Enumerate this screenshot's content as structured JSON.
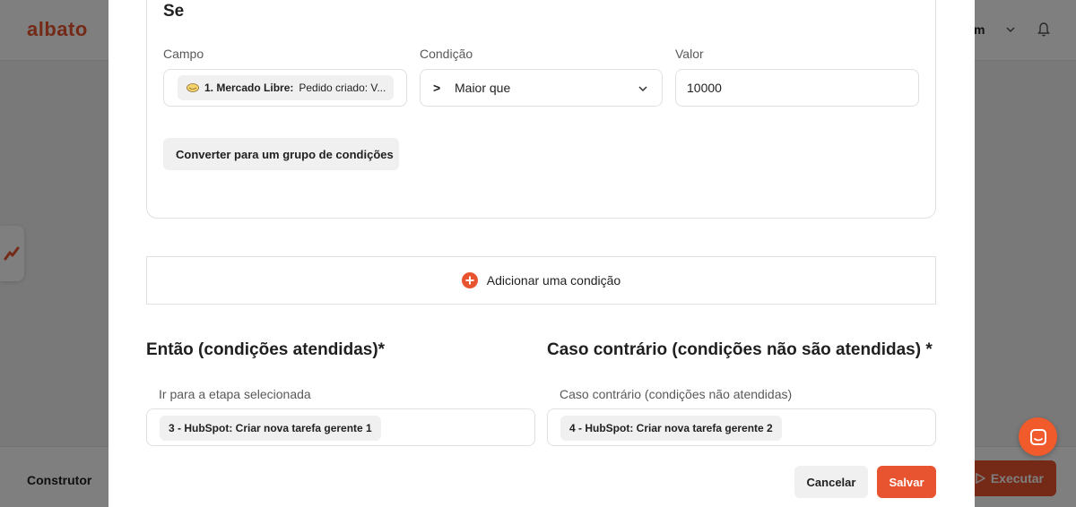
{
  "app": {
    "logo": "albato",
    "user_fragment": "m",
    "builder_label": "Construtor",
    "run_label": "Executar"
  },
  "colors": {
    "accent": "#e8542f",
    "chip_bg": "#f0f0f0",
    "border": "#e0e0e0"
  },
  "modal": {
    "if_title": "Se",
    "field_label": "Campo",
    "field_chip": {
      "bold": "1. Mercado Libre:",
      "rest": "Pedido criado: V..."
    },
    "condition_label": "Condição",
    "condition_op": ">",
    "condition_value": "Maior que",
    "value_label": "Valor",
    "value": "10000",
    "convert_label": "Converter para um grupo de condições",
    "add_condition_label": "Adicionar uma condição",
    "then_title": "Então (condições atendidas)*",
    "then_sub": "Ir para a etapa selecionada",
    "then_step": "3 - HubSpot: Criar nova tarefa gerente 1",
    "else_title": "Caso contrário (condições não são atendidas) *",
    "else_sub": "Caso contrário (condições não atendidas)",
    "else_step": "4 - HubSpot: Criar nova tarefa gerente 2",
    "cancel_label": "Cancelar",
    "save_label": "Salvar"
  }
}
